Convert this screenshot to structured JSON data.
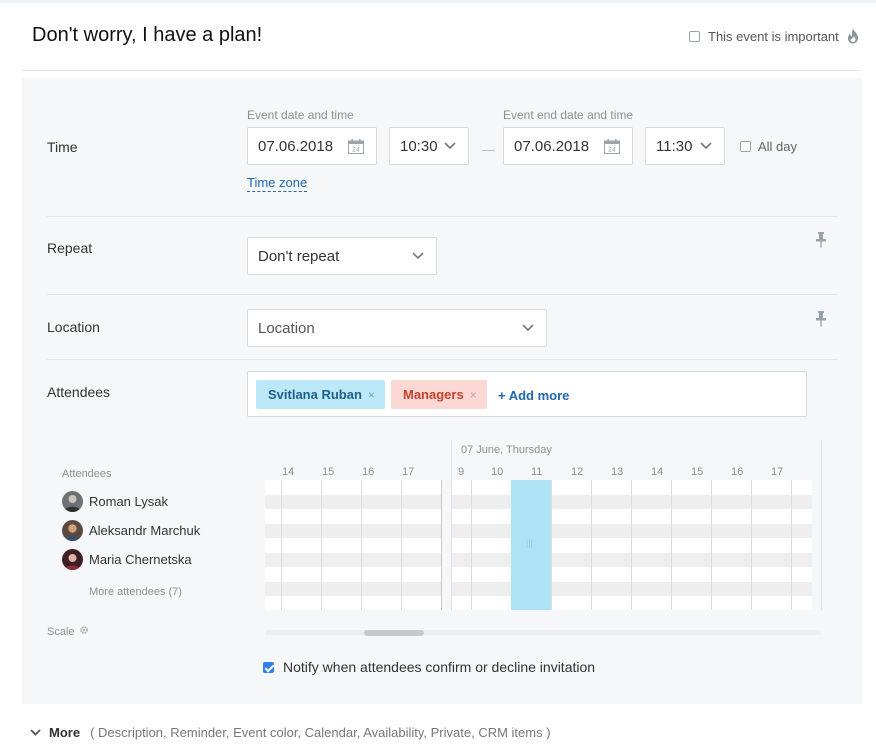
{
  "event": {
    "title": "Don't worry, I have a plan!",
    "important_label": "This event is important"
  },
  "time": {
    "label": "Time",
    "start_caption": "Event date and time",
    "end_caption": "Event end date and time",
    "start_date": "07.06.2018",
    "start_time": "10:30",
    "end_date": "07.06.2018",
    "end_time": "11:30",
    "allday_label": "All day",
    "timezone_link": "Time zone",
    "calendar_day": "24"
  },
  "repeat": {
    "label": "Repeat",
    "value": "Don't repeat"
  },
  "location": {
    "label": "Location",
    "placeholder": "Location"
  },
  "attendees": {
    "label": "Attendees",
    "tags": [
      {
        "name": "Svitlana Ruban",
        "color": "#bce8f7"
      },
      {
        "name": "Managers",
        "color": "#fbd8d3"
      }
    ],
    "remove_glyph": "×",
    "add_more": "+ Add more"
  },
  "planner": {
    "attendees_caption": "Attendees",
    "date_header": "07 June, Thursday",
    "hours_prev": [
      "14",
      "15",
      "16",
      "17"
    ],
    "hours_day": [
      "9",
      "10",
      "11",
      "12",
      "13",
      "14",
      "15",
      "16",
      "17"
    ],
    "people": [
      {
        "name": "Roman Lysak"
      },
      {
        "name": "Aleksandr Marchuk"
      },
      {
        "name": "Maria Chernetska"
      }
    ],
    "more_attendees": "More attendees (7)",
    "scale_label": "Scale",
    "selection_mark": "|||"
  },
  "notify": {
    "checked": true,
    "label": "Notify when attendees confirm or decline invitation"
  },
  "more": {
    "label": "More",
    "items": "( Description,  Reminder,  Event color,  Calendar,  Availability,  Private,  CRM items )"
  },
  "colors": {
    "accent": "#2067b0",
    "selection": "#aee3f6",
    "panel": "#f5f7f8"
  }
}
